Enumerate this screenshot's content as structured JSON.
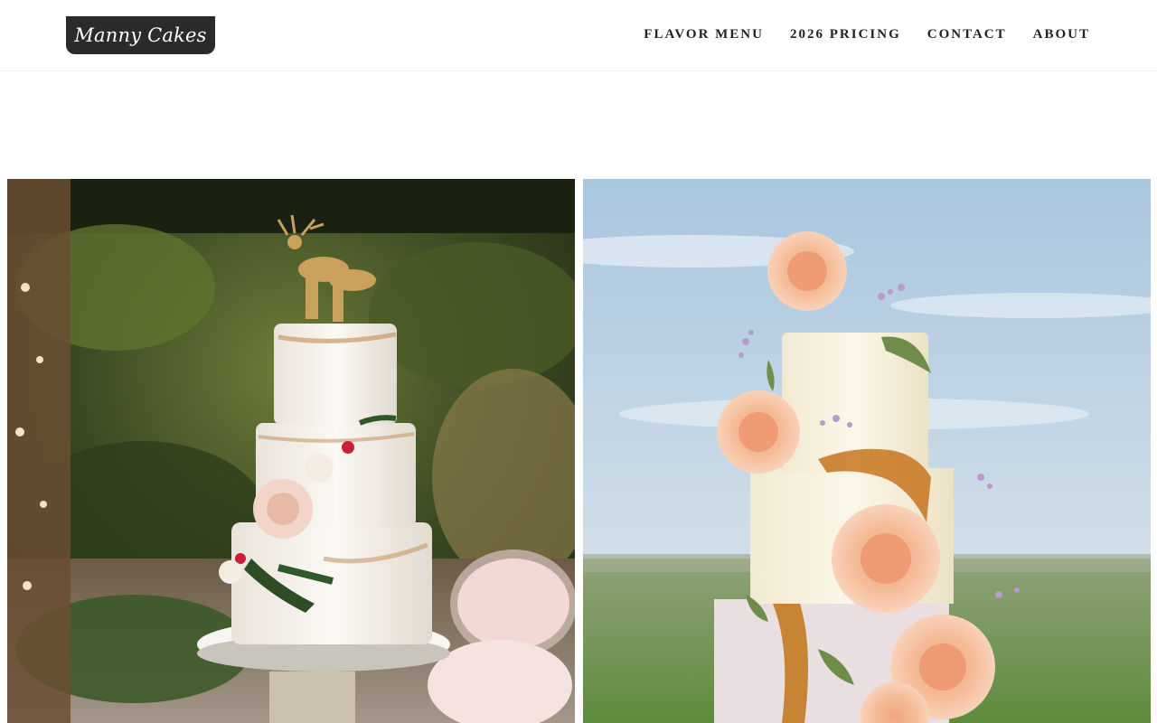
{
  "brand": {
    "logo_text": "Manny Cakes",
    "logo_bg": "#2b2b2b"
  },
  "nav": {
    "items": [
      {
        "label": "FLAVOR MENU"
      },
      {
        "label": "2026 PRICING"
      },
      {
        "label": "CONTACT"
      },
      {
        "label": "ABOUT"
      }
    ]
  },
  "gallery": {
    "photos": [
      {
        "subject": "three-tier semi-naked white wedding cake with gold deer topper and roses, garden background"
      },
      {
        "subject": "tall cream wedding cake with peach roses and amaranth, sky and field background"
      }
    ]
  }
}
